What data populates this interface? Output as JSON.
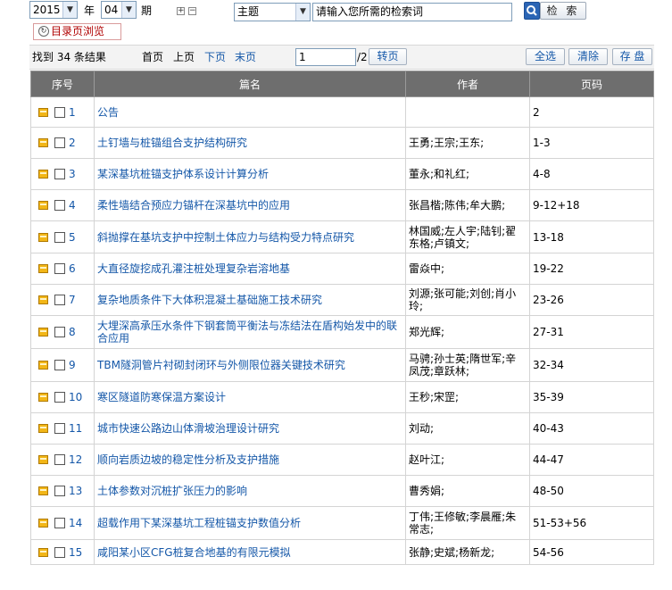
{
  "filters": {
    "year": "2015",
    "year_label": "年",
    "issue": "04",
    "issue_label": "期",
    "tree_plus": "⊞",
    "tree_minus": "⊟",
    "field": "主题",
    "search_placeholder": "请输入您所需的检索词",
    "search_button": "检 索"
  },
  "toc_button": "目录页浏览",
  "results": {
    "found": "找到 34 条结果",
    "first": "首页",
    "prev": "上页",
    "next": "下页",
    "last": "末页",
    "page": "1",
    "total_pages": "/2",
    "goto": "转页",
    "select_all": "全选",
    "clear": "清除",
    "save": "存 盘"
  },
  "table": {
    "headers": {
      "seq": "序号",
      "title": "篇名",
      "author": "作者",
      "pages": "页码"
    },
    "rows": [
      {
        "no": "1",
        "title": "公告",
        "author": "",
        "pages": "2"
      },
      {
        "no": "2",
        "title": "土钉墙与桩锚组合支护结构研究",
        "author": "王勇;王宗;王东;",
        "pages": "1-3"
      },
      {
        "no": "3",
        "title": "某深基坑桩锚支护体系设计计算分析",
        "author": "董永;和礼红;",
        "pages": "4-8"
      },
      {
        "no": "4",
        "title": "柔性墙结合预应力锚杆在深基坑中的应用",
        "author": "张昌楷;陈伟;牟大鹏;",
        "pages": "9-12+18"
      },
      {
        "no": "5",
        "title": "斜抛撑在基坑支护中控制土体应力与结构受力特点研究",
        "author": "林国威;左人宇;陆钊;翟东格;卢镇文;",
        "pages": "13-18"
      },
      {
        "no": "6",
        "title": "大直径旋挖成孔灌注桩处理复杂岩溶地基",
        "author": "雷焱中;",
        "pages": "19-22"
      },
      {
        "no": "7",
        "title": "复杂地质条件下大体积混凝土基础施工技术研究",
        "author": "刘源;张可能;刘创;肖小玲;",
        "pages": "23-26"
      },
      {
        "no": "8",
        "title": "大埋深高承压水条件下钢套筒平衡法与冻结法在盾构始发中的联合应用",
        "author": "郑光辉;",
        "pages": "27-31"
      },
      {
        "no": "9",
        "title": "TBM隧洞管片衬砌封闭环与外侧限位器关键技术研究",
        "author": "马骋;孙士英;隋世军;辛凤茂;章跃林;",
        "pages": "32-34"
      },
      {
        "no": "10",
        "title": "寒区隧道防寒保温方案设计",
        "author": "王秒;宋罡;",
        "pages": "35-39"
      },
      {
        "no": "11",
        "title": "城市快速公路边山体滑坡治理设计研究",
        "author": "刘动;",
        "pages": "40-43"
      },
      {
        "no": "12",
        "title": "顺向岩质边坡的稳定性分析及支护措施",
        "author": "赵叶江;",
        "pages": "44-47"
      },
      {
        "no": "13",
        "title": "土体参数对沉桩扩张压力的影响",
        "author": "曹秀娟;",
        "pages": "48-50"
      },
      {
        "no": "14",
        "title": "超载作用下某深基坑工程桩锚支护数值分析",
        "author": "丁伟;王修敏;李晨雁;朱常志;",
        "pages": "51-53+56"
      },
      {
        "no": "15",
        "title": "咸阳某小区CFG桩复合地基的有限元模拟",
        "author": "张静;史斌;杨新龙;",
        "pages": "54-56"
      }
    ]
  },
  "colors": {
    "header_bg": "#6e6e6e",
    "link": "#1457a8",
    "toc_text": "#b00000"
  }
}
